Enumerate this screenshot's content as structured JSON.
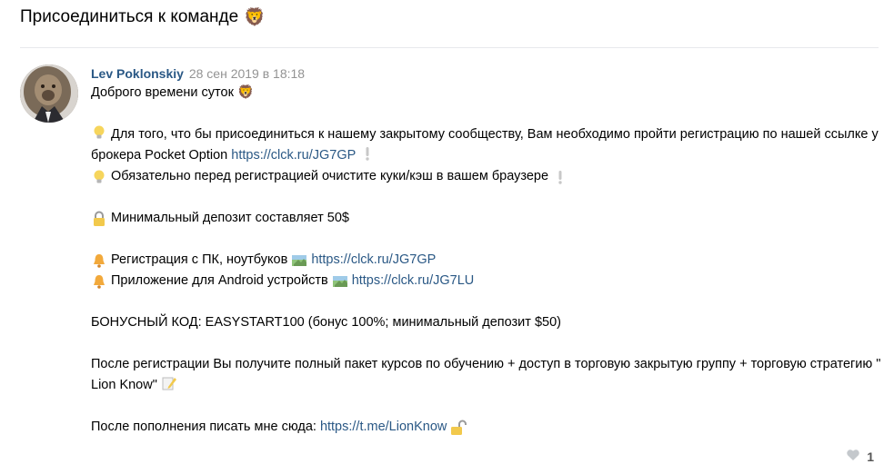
{
  "topic": {
    "title": "Присоединиться к команде",
    "title_emoji": "🦁"
  },
  "post": {
    "author": "Lev Poklonskiy",
    "date": "28 сен 2019 в 18:18",
    "greeting": "Доброго времени суток",
    "greeting_emoji": "🦁",
    "line1_text": "Для того, что бы присоединиться к нашему закрытому сообществу, Вам необходимо пройти регистрацию по нашей ссылке у брокера Pocket Option ",
    "line1_link": "https://clck.ru/JG7GP",
    "line2_text": "Обязательно перед регистрацией очистите куки/кэш в вашем браузере",
    "deposit_text": "Минимальный депозит составляет 50$",
    "reg_pc_text": "Регистрация с ПК, ноутбуков",
    "reg_pc_link": "https://clck.ru/JG7GP",
    "reg_android_text": "Приложение для Android устройств",
    "reg_android_link": "https://clck.ru/JG7LU",
    "bonus_text": "БОНУСНЫЙ КОД: EASYSTART100 (бонус 100%; минимальный депозит $50)",
    "after_reg_text": "После регистрации Вы получите полный пакет курсов по обучению + доступ в торговую закрытую группу + торговую стратегию \" Lion Know\"",
    "contact_text": "После пополнения писать мне сюда: ",
    "contact_link": "https://t.me/LionKnow"
  },
  "likes": {
    "count": "1"
  },
  "icons": {
    "bulb": "lightbulb-icon",
    "exclamation": "exclamation-icon",
    "lock": "lock-icon",
    "bell": "bell-icon",
    "map": "map-icon",
    "memo": "memo-icon",
    "unlock": "unlock-icon",
    "heart": "heart-icon"
  },
  "colors": {
    "link": "#2a5885",
    "date": "#939393",
    "divider": "#e7e8ec"
  }
}
